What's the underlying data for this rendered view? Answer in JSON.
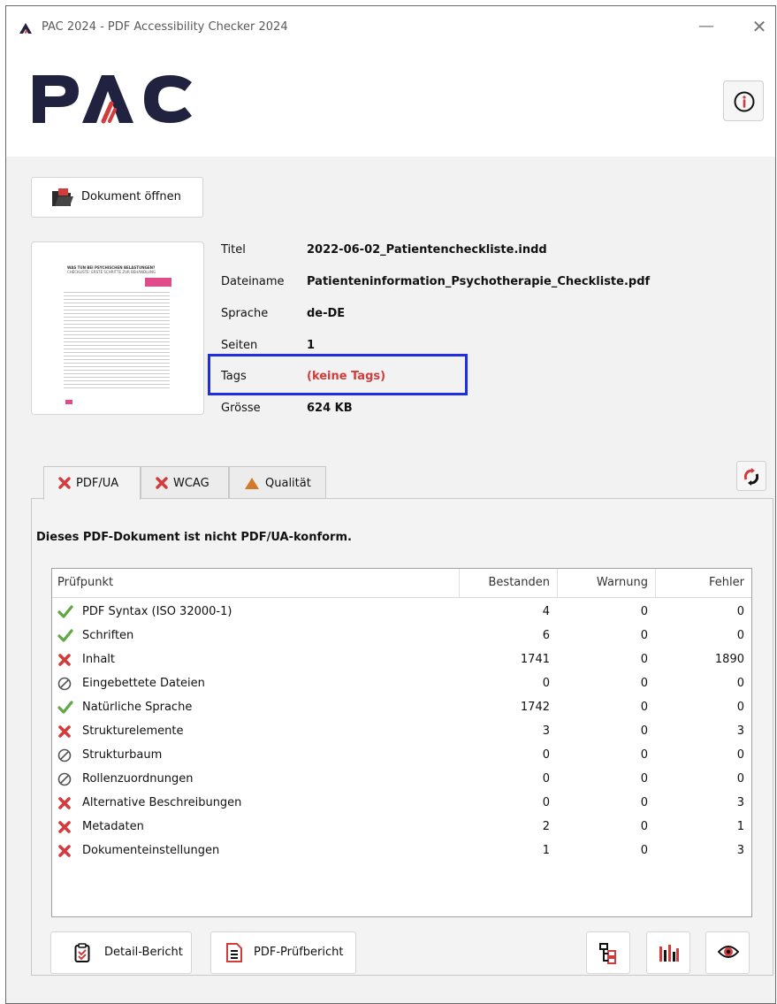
{
  "window": {
    "title": "PAC 2024 - PDF Accessibility Checker 2024",
    "minimize_icon": "minimize-icon",
    "close_icon": "close-icon"
  },
  "header": {
    "logo_text": "PAC",
    "info_icon": "info-icon"
  },
  "toolbar": {
    "open_label": "Dokument öffnen"
  },
  "meta": {
    "labels": {
      "title": "Titel",
      "filename": "Dateiname",
      "language": "Sprache",
      "pages": "Seiten",
      "tags": "Tags",
      "size": "Grösse"
    },
    "values": {
      "title": "2022-06-02_Patientencheckliste.indd",
      "filename": "Patienteninformation_Psychotherapie_Checkliste.pdf",
      "language": "de-DE",
      "pages": "1",
      "tags": "(keine Tags)",
      "size": "624 KB"
    }
  },
  "tabs": [
    {
      "label": "PDF/UA",
      "icon": "x-icon",
      "active": true
    },
    {
      "label": "WCAG",
      "icon": "x-icon",
      "active": false
    },
    {
      "label": "Qualität",
      "icon": "warning-triangle-icon",
      "active": false
    }
  ],
  "summary": "Dieses PDF-Dokument ist nicht PDF/UA-konform.",
  "table": {
    "columns": [
      "Prüfpunkt",
      "Bestanden",
      "Warnung",
      "Fehler"
    ],
    "rows": [
      {
        "status": "pass",
        "name": "PDF Syntax (ISO 32000-1)",
        "passed": "4",
        "warnings": "0",
        "errors": "0"
      },
      {
        "status": "pass",
        "name": "Schriften",
        "passed": "6",
        "warnings": "0",
        "errors": "0"
      },
      {
        "status": "fail",
        "name": "Inhalt",
        "passed": "1741",
        "warnings": "0",
        "errors": "1890"
      },
      {
        "status": "na",
        "name": "Eingebettete Dateien",
        "passed": "0",
        "warnings": "0",
        "errors": "0"
      },
      {
        "status": "pass",
        "name": "Natürliche Sprache",
        "passed": "1742",
        "warnings": "0",
        "errors": "0"
      },
      {
        "status": "fail",
        "name": "Strukturelemente",
        "passed": "3",
        "warnings": "0",
        "errors": "3"
      },
      {
        "status": "na",
        "name": "Strukturbaum",
        "passed": "0",
        "warnings": "0",
        "errors": "0"
      },
      {
        "status": "na",
        "name": "Rollenzuordnungen",
        "passed": "0",
        "warnings": "0",
        "errors": "0"
      },
      {
        "status": "fail",
        "name": "Alternative Beschreibungen",
        "passed": "0",
        "warnings": "0",
        "errors": "3"
      },
      {
        "status": "fail",
        "name": "Metadaten",
        "passed": "2",
        "warnings": "0",
        "errors": "1"
      },
      {
        "status": "fail",
        "name": "Dokumenteinstellungen",
        "passed": "1",
        "warnings": "0",
        "errors": "3"
      }
    ]
  },
  "bottom": {
    "detail_label": "Detail-Bericht",
    "report_label": "PDF-Prüfbericht"
  },
  "thumbnail": {
    "heading": "WAS TUN BEI PSYCHISCHEN BELASTUNGEN?",
    "subheading": "CHECKLISTE: ERSTE SCHRITTE ZUR BEHANDLUNG"
  },
  "colors": {
    "accent_red": "#d23c3c",
    "pass_green": "#5fa845",
    "warning_orange": "#d27a2a",
    "highlight_blue": "#1f2ee0",
    "logo_dark": "#21223f"
  }
}
